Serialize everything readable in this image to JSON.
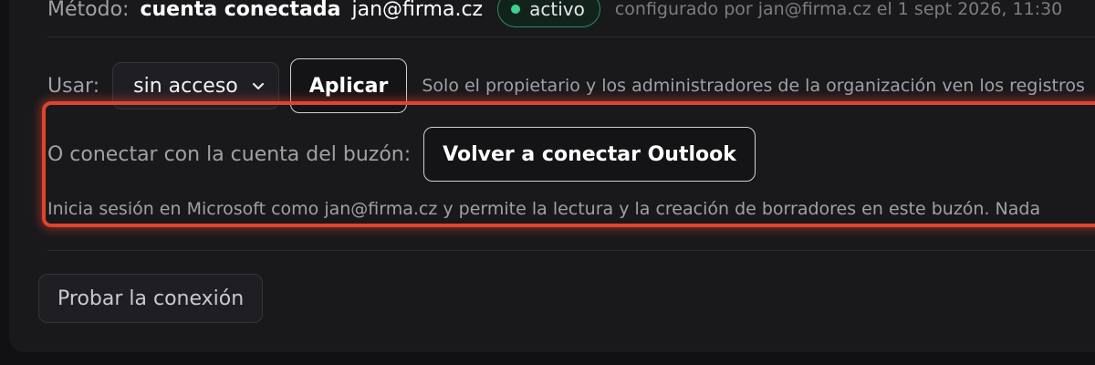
{
  "method": {
    "label": "Método:",
    "type": "cuenta conectada",
    "account": "jan@firma.cz",
    "status": "activo",
    "status_color": "#3ed08c",
    "configured_by": "configurado por jan@firma.cz el 1 sept 2026, 11:30"
  },
  "use": {
    "label": "Usar:",
    "selected": "sin acceso",
    "apply_label": "Aplicar",
    "hint": "Solo el propietario y los administradores de la organización ven los registros"
  },
  "connect": {
    "label": "O conectar con la cuenta del buzón:",
    "button_label": "Volver a conectar Outlook",
    "description": "Inicia sesión en Microsoft como jan@firma.cz y permite la lectura y la creación de borradores en este buzón. Nada"
  },
  "test": {
    "button_label": "Probar la conexión"
  },
  "highlight_color": "#e0432f"
}
